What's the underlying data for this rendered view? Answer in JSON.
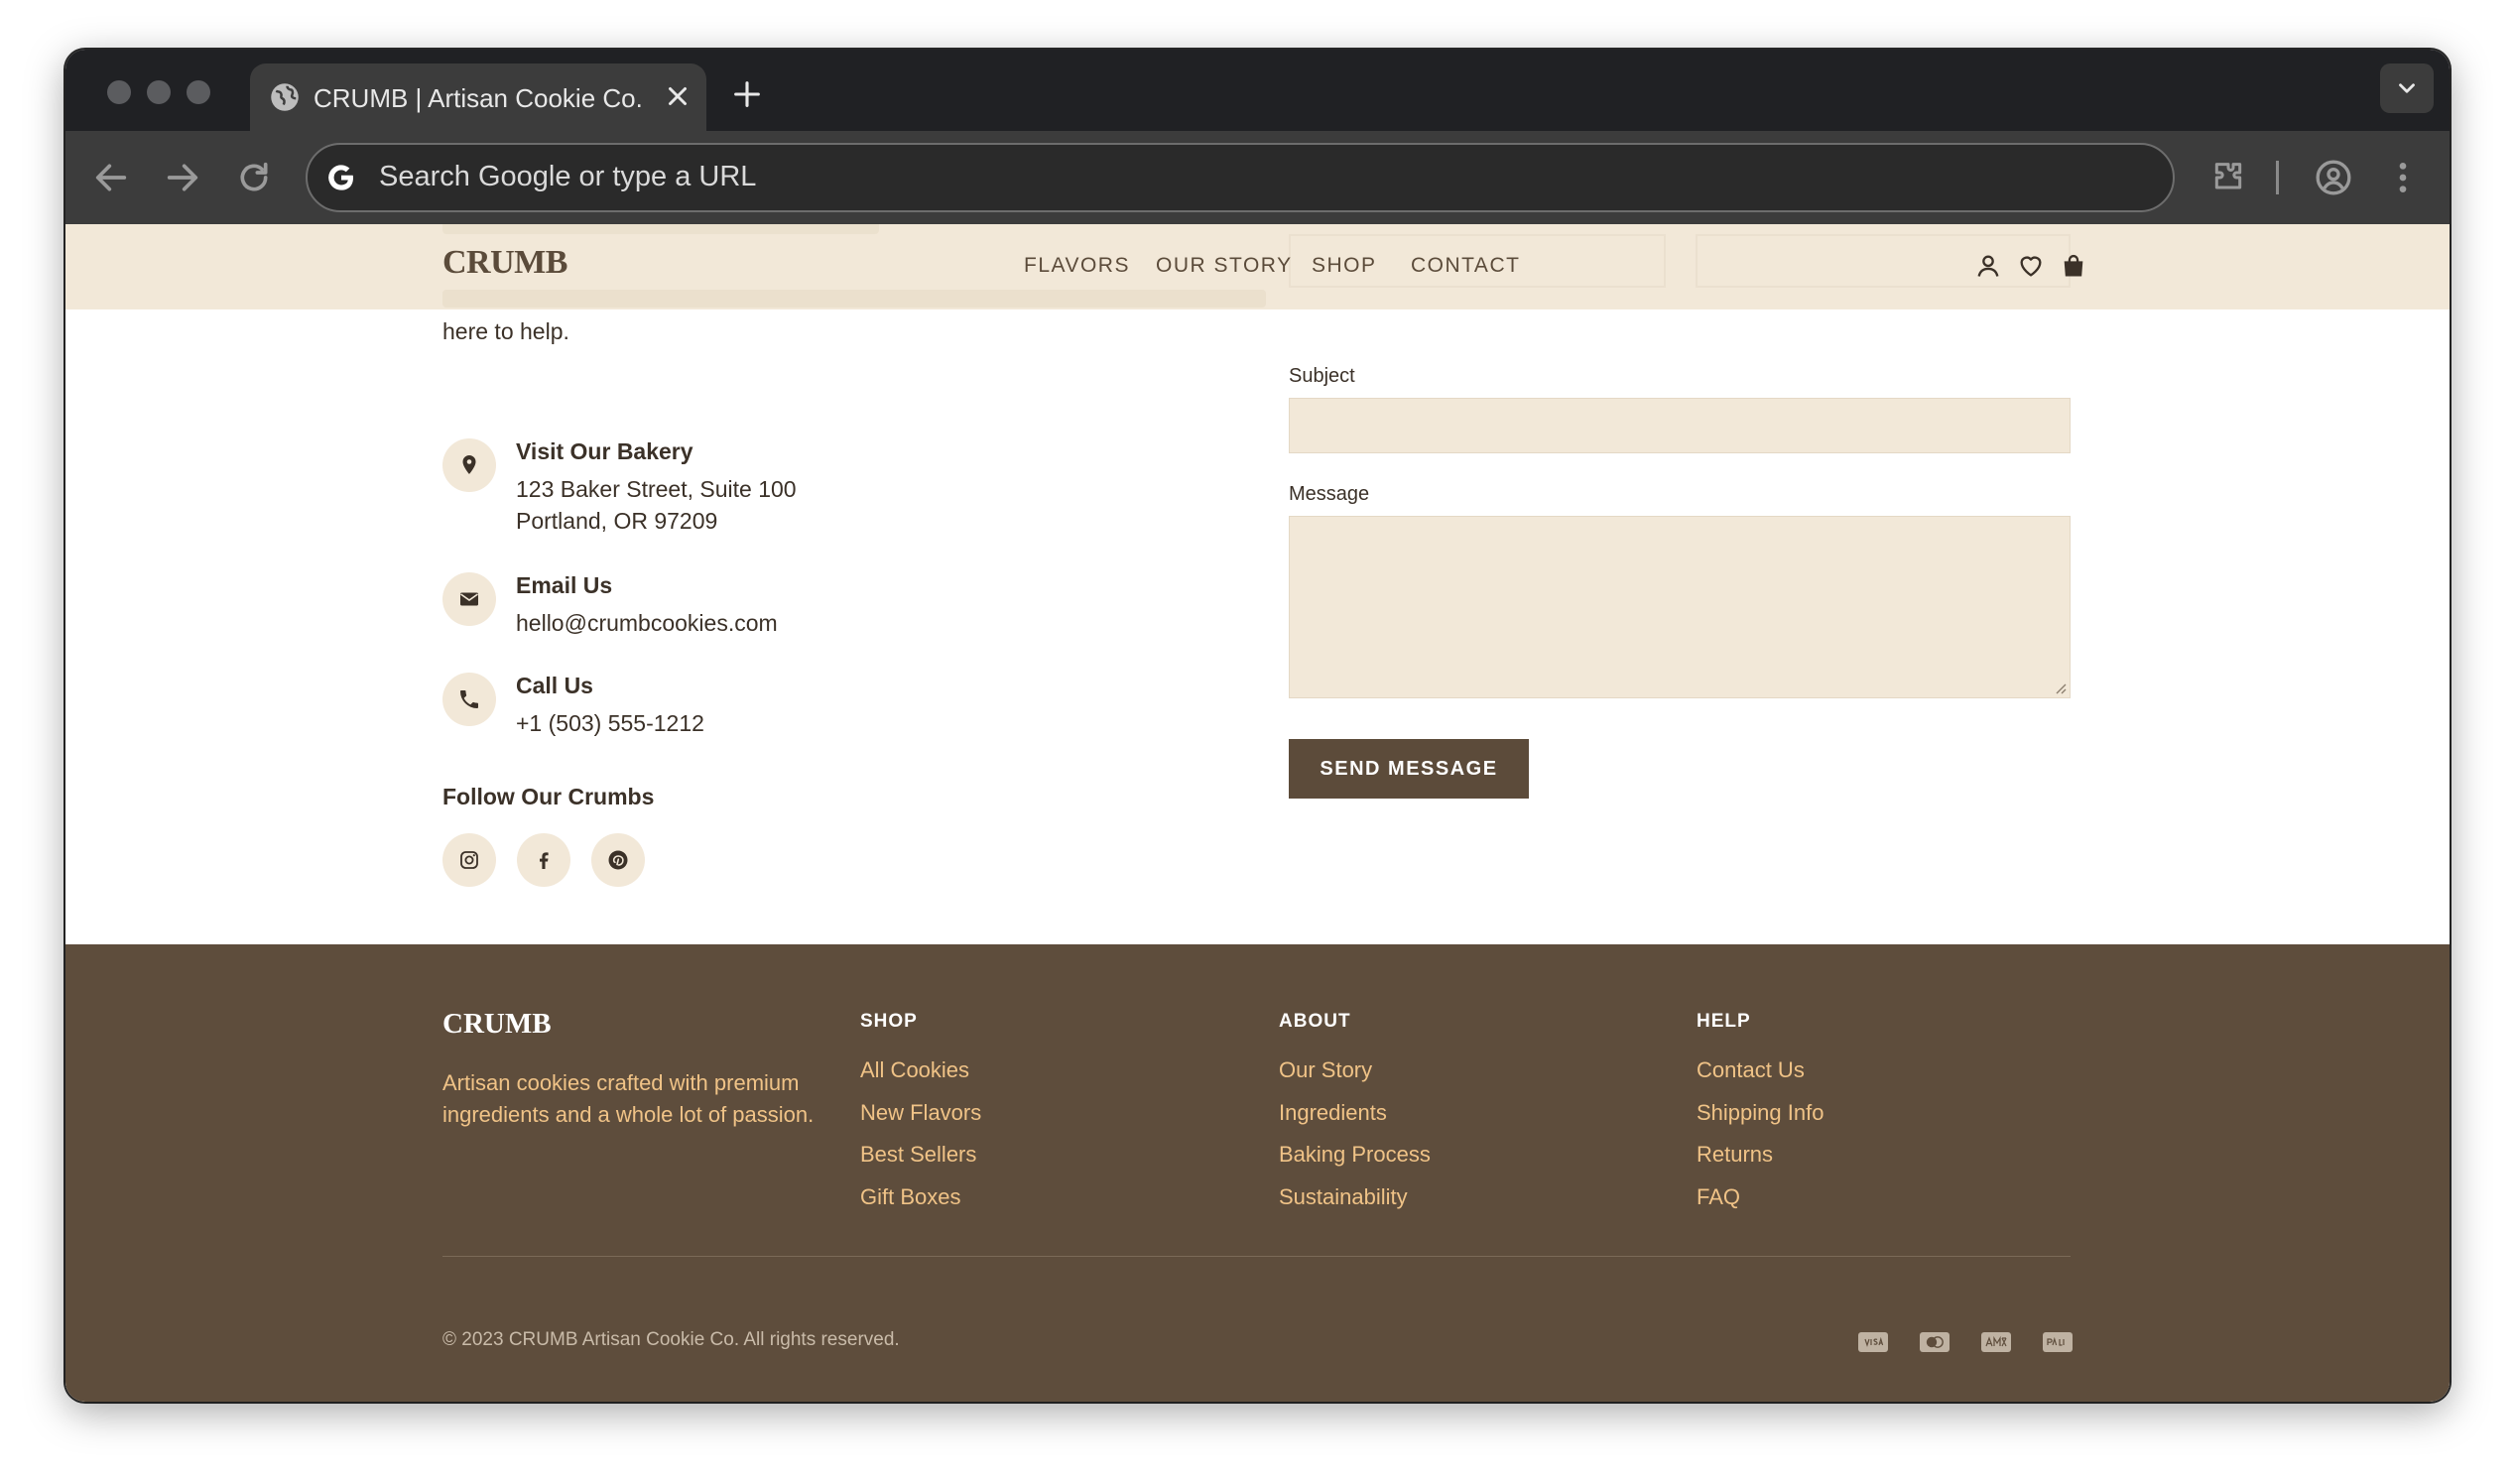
{
  "browser": {
    "tab_title": "CRUMB | Artisan Cookie Co.",
    "omnibox_placeholder": "Search Google or type a URL"
  },
  "header": {
    "logo": "CRUMB",
    "nav": [
      "FLAVORS",
      "OUR STORY",
      "SHOP",
      "CONTACT"
    ]
  },
  "contact": {
    "intro_tail": "here to help.",
    "items": [
      {
        "title": "Visit Our Bakery",
        "lines": [
          "123 Baker Street, Suite 100",
          "Portland, OR 97209"
        ],
        "icon": "map-pin-icon"
      },
      {
        "title": "Email Us",
        "lines": [
          "hello@crumbcookies.com"
        ],
        "icon": "envelope-icon"
      },
      {
        "title": "Call Us",
        "lines": [
          "+1 (503) 555-1212"
        ],
        "icon": "phone-icon"
      }
    ],
    "follow_title": "Follow Our Crumbs",
    "socials": [
      "instagram-icon",
      "facebook-icon",
      "pinterest-icon"
    ]
  },
  "form": {
    "subject_label": "Subject",
    "subject_value": "",
    "message_label": "Message",
    "message_value": "",
    "submit_label": "SEND MESSAGE"
  },
  "footer": {
    "logo": "CRUMB",
    "description": "Artisan cookies crafted with premium ingredients and a whole lot of passion.",
    "columns": [
      {
        "title": "SHOP",
        "links": [
          "All Cookies",
          "New Flavors",
          "Best Sellers",
          "Gift Boxes"
        ]
      },
      {
        "title": "ABOUT",
        "links": [
          "Our Story",
          "Ingredients",
          "Baking Process",
          "Sustainability"
        ]
      },
      {
        "title": "HELP",
        "links": [
          "Contact Us",
          "Shipping Info",
          "Returns",
          "FAQ"
        ]
      }
    ],
    "copyright": "© 2023 CRUMB Artisan Cookie Co. All rights reserved.",
    "payment_icons": [
      "visa-icon",
      "mastercard-icon",
      "amex-icon",
      "paypal-icon"
    ]
  },
  "colors": {
    "cream": "#f2e8d8",
    "brown": "#5e4d3c",
    "accent": "#f0c387",
    "text": "#3b3128"
  }
}
